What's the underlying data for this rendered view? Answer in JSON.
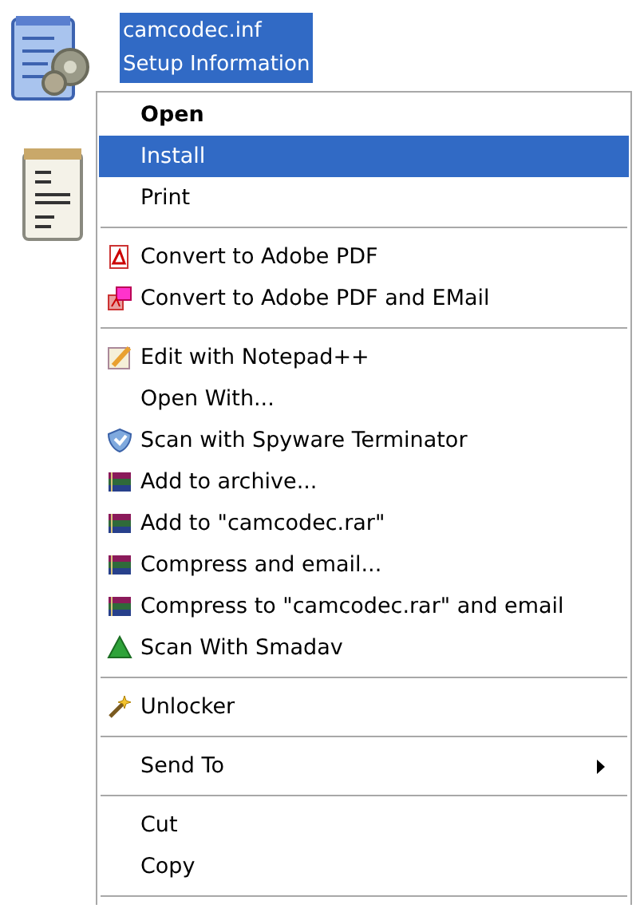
{
  "desktop_icon": {
    "file_name": "camcodec.inf",
    "file_type": "Setup Information",
    "selected": true
  },
  "context_menu": {
    "items": [
      {
        "kind": "item",
        "label": "Open",
        "default": true,
        "selected": false
      },
      {
        "kind": "item",
        "label": "Install",
        "default": false,
        "selected": true
      },
      {
        "kind": "item",
        "label": "Print",
        "default": false,
        "selected": false
      },
      {
        "kind": "separator"
      },
      {
        "kind": "item",
        "label": "Convert to Adobe PDF",
        "default": false,
        "selected": false
      },
      {
        "kind": "item",
        "label": "Convert to Adobe PDF and EMail",
        "default": false,
        "selected": false
      },
      {
        "kind": "separator"
      },
      {
        "kind": "item",
        "label": "Edit with Notepad++",
        "default": false,
        "selected": false
      },
      {
        "kind": "item",
        "label": "Open With...",
        "default": false,
        "selected": false
      },
      {
        "kind": "item",
        "label": "Scan with Spyware Terminator",
        "default": false,
        "selected": false
      },
      {
        "kind": "item",
        "label": "Add to archive...",
        "default": false,
        "selected": false
      },
      {
        "kind": "item",
        "label": "Add to \"camcodec.rar\"",
        "default": false,
        "selected": false
      },
      {
        "kind": "item",
        "label": "Compress and email...",
        "default": false,
        "selected": false
      },
      {
        "kind": "item",
        "label": "Compress to \"camcodec.rar\" and email",
        "default": false,
        "selected": false
      },
      {
        "kind": "item",
        "label": "Scan With Smadav",
        "default": false,
        "selected": false
      },
      {
        "kind": "separator"
      },
      {
        "kind": "item",
        "label": "Unlocker",
        "default": false,
        "selected": false
      },
      {
        "kind": "separator"
      },
      {
        "kind": "item",
        "label": "Send To",
        "default": false,
        "selected": false,
        "submenu": true
      },
      {
        "kind": "separator"
      },
      {
        "kind": "item",
        "label": "Cut",
        "default": false,
        "selected": false
      },
      {
        "kind": "item",
        "label": "Copy",
        "default": false,
        "selected": false
      },
      {
        "kind": "separator"
      }
    ]
  }
}
